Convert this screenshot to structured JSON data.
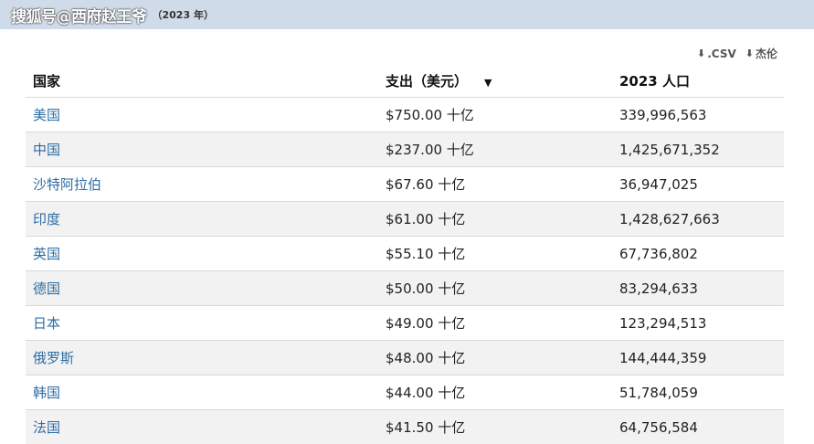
{
  "header": {
    "watermark": "搜狐号@西府赵王爷",
    "year": "（2023 年）"
  },
  "downloads": {
    "csv_label": ".CSV",
    "other_label": "杰伦"
  },
  "table": {
    "columns": [
      "国家",
      "支出（美元）",
      "2023 人口"
    ],
    "rows": [
      {
        "country": "美国",
        "spending": "$750.00 十亿",
        "population": "339,996,563"
      },
      {
        "country": "中国",
        "spending": "$237.00 十亿",
        "population": "1,425,671,352"
      },
      {
        "country": "沙特阿拉伯",
        "spending": "$67.60 十亿",
        "population": "36,947,025"
      },
      {
        "country": "印度",
        "spending": "$61.00 十亿",
        "population": "1,428,627,663"
      },
      {
        "country": "英国",
        "spending": "$55.10 十亿",
        "population": "67,736,802"
      },
      {
        "country": "德国",
        "spending": "$50.00 十亿",
        "population": "83,294,633"
      },
      {
        "country": "日本",
        "spending": "$49.00 十亿",
        "population": "123,294,513"
      },
      {
        "country": "俄罗斯",
        "spending": "$48.00 十亿",
        "population": "144,444,359"
      },
      {
        "country": "韩国",
        "spending": "$44.00 十亿",
        "population": "51,784,059"
      },
      {
        "country": "法国",
        "spending": "$41.50 十亿",
        "population": "64,756,584"
      }
    ]
  }
}
